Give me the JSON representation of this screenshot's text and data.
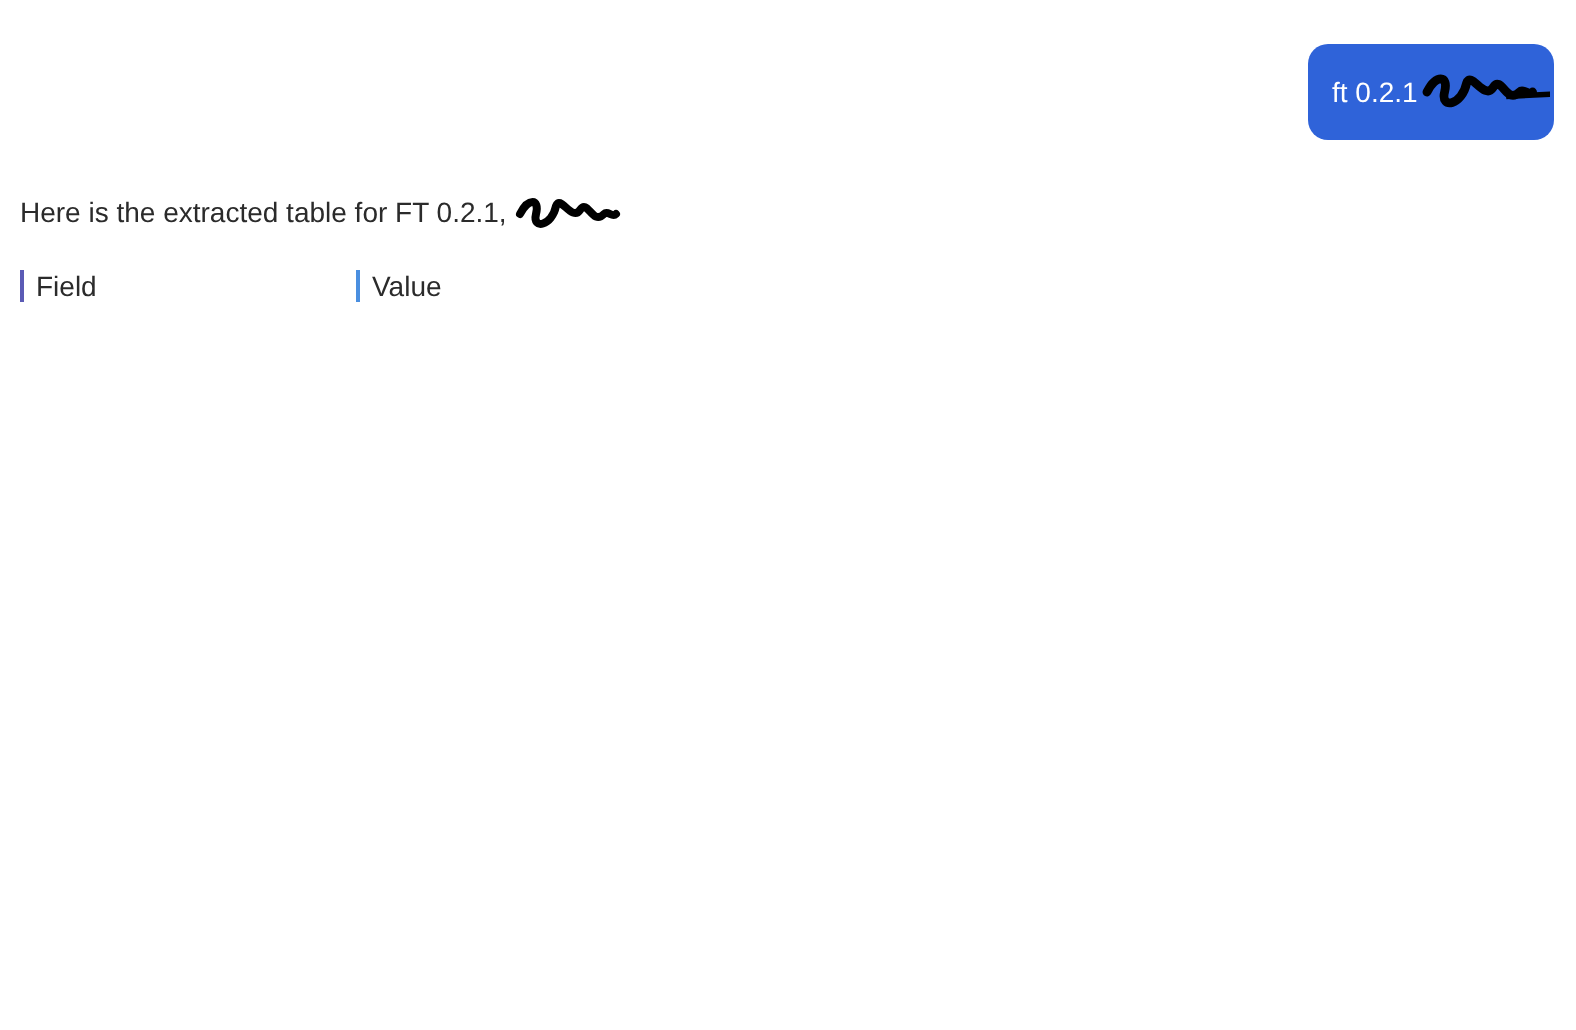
{
  "user_message": {
    "text": "ft 0.2.1",
    "redacted": true
  },
  "assistant_message": {
    "text": "Here is the extracted table for FT 0.2.1,",
    "redacted": true
  },
  "table": {
    "columns": [
      "Field",
      "Value"
    ]
  }
}
